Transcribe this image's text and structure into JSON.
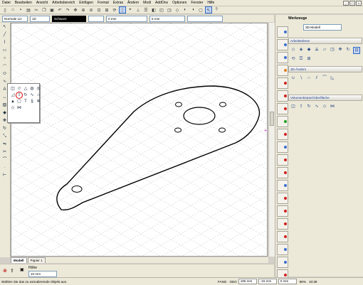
{
  "menu": [
    "Datei",
    "Bearbeiten",
    "Ansicht",
    "Arbeitsbereich",
    "Einfügen",
    "Format",
    "Extras",
    "Ändern",
    "Modi",
    "AddOns",
    "Optionen",
    "Fenster",
    "Hilfe"
  ],
  "toolbar2": {
    "style": "Normale Lin",
    "thickness": "1D",
    "color": "Schwarz",
    "field1": "0 mm",
    "field2": "5 mm"
  },
  "panel": {
    "title": "Werkzeuge",
    "mode": "3D-Modell",
    "sections": [
      {
        "title": "Arbeitsebene"
      },
      {
        "title": "3D-Ändern"
      },
      {
        "title": "Volumenkörper/Oberfläche"
      }
    ]
  },
  "tabs": [
    {
      "label": "Modell"
    },
    {
      "label": "Papier 1"
    }
  ],
  "bottom": {
    "label": "Höhe",
    "value": "10 mm"
  },
  "status": {
    "hint": "Wählen Sie das zu extrudierende Objekt aus.",
    "fangs": "FANG",
    "geo": "GEO",
    "x": "195 mm",
    "y": "-15 mm",
    "z": "0 mm",
    "zoom": "96%",
    "time": "10:39"
  },
  "icons": {
    "flyout": [
      "box-icon",
      "cylinder-icon",
      "cone-icon",
      "sphere-icon",
      "torus-icon",
      "extrude-icon",
      "revolve-icon",
      "sweep-icon",
      "loft-icon",
      "wedge-icon",
      "pyramid-icon",
      "shell-icon",
      "text3d-icon",
      "spring-icon",
      "gear3d-icon",
      "surface-icon",
      "mesh-icon"
    ]
  }
}
